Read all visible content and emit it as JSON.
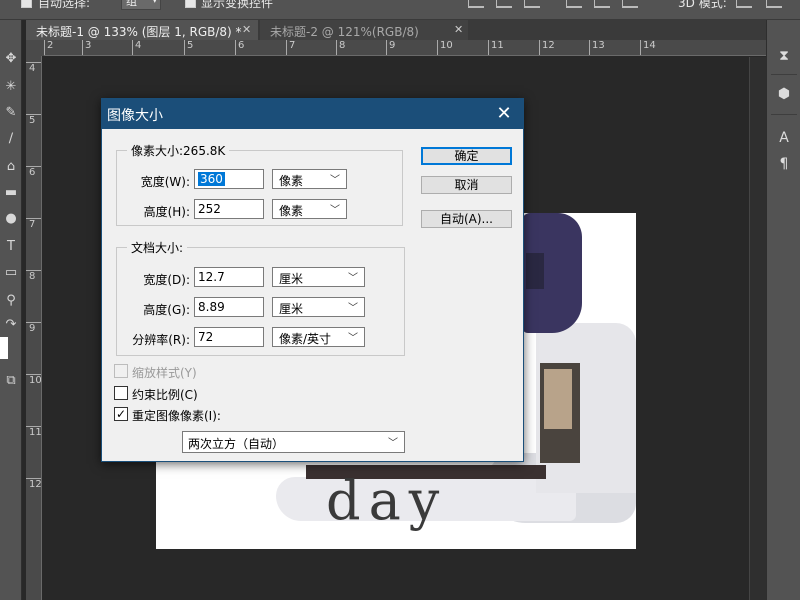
{
  "options_bar": {
    "auto_select_label": "自动选择:",
    "auto_select_value": "组",
    "show_transform_label": "显示变换控件",
    "mode_3d_label": "3D 模式:"
  },
  "tabs": [
    {
      "title": "未标题-1 @ 133% (图层 1, RGB/8) *",
      "active": true
    },
    {
      "title": "未标题-2 @ 121%(RGB/8)",
      "active": false
    }
  ],
  "ruler_top": [
    "2",
    "3",
    "4",
    "5",
    "6",
    "7",
    "8",
    "9",
    "10",
    "11",
    "12",
    "13",
    "14"
  ],
  "ruler_left": [
    "4",
    "5",
    "6",
    "7",
    "8",
    "9",
    "10",
    "11",
    "12"
  ],
  "document": {
    "text": "day"
  },
  "dialog": {
    "title": "图像大小",
    "pixel_group": {
      "legend": "像素大小:265.8K",
      "width_label": "宽度(W):",
      "width_value": "360",
      "width_unit": "像素",
      "height_label": "高度(H):",
      "height_value": "252",
      "height_unit": "像素"
    },
    "doc_group": {
      "legend": "文档大小:",
      "width_label": "宽度(D):",
      "width_value": "12.7",
      "width_unit": "厘米",
      "height_label": "高度(G):",
      "height_value": "8.89",
      "height_unit": "厘米",
      "resolution_label": "分辨率(R):",
      "resolution_value": "72",
      "resolution_unit": "像素/英寸"
    },
    "buttons": {
      "ok": "确定",
      "cancel": "取消",
      "auto": "自动(A)..."
    },
    "checkboxes": {
      "scale_styles": "缩放样式(Y)",
      "constrain": "约束比例(C)",
      "resample": "重定图像像素(I):"
    },
    "resample_method": "两次立方（自动）"
  },
  "colors": {
    "dialog_title_bg": "#1b4e79",
    "accent": "#0078d7",
    "arrow": "#d0231a"
  }
}
